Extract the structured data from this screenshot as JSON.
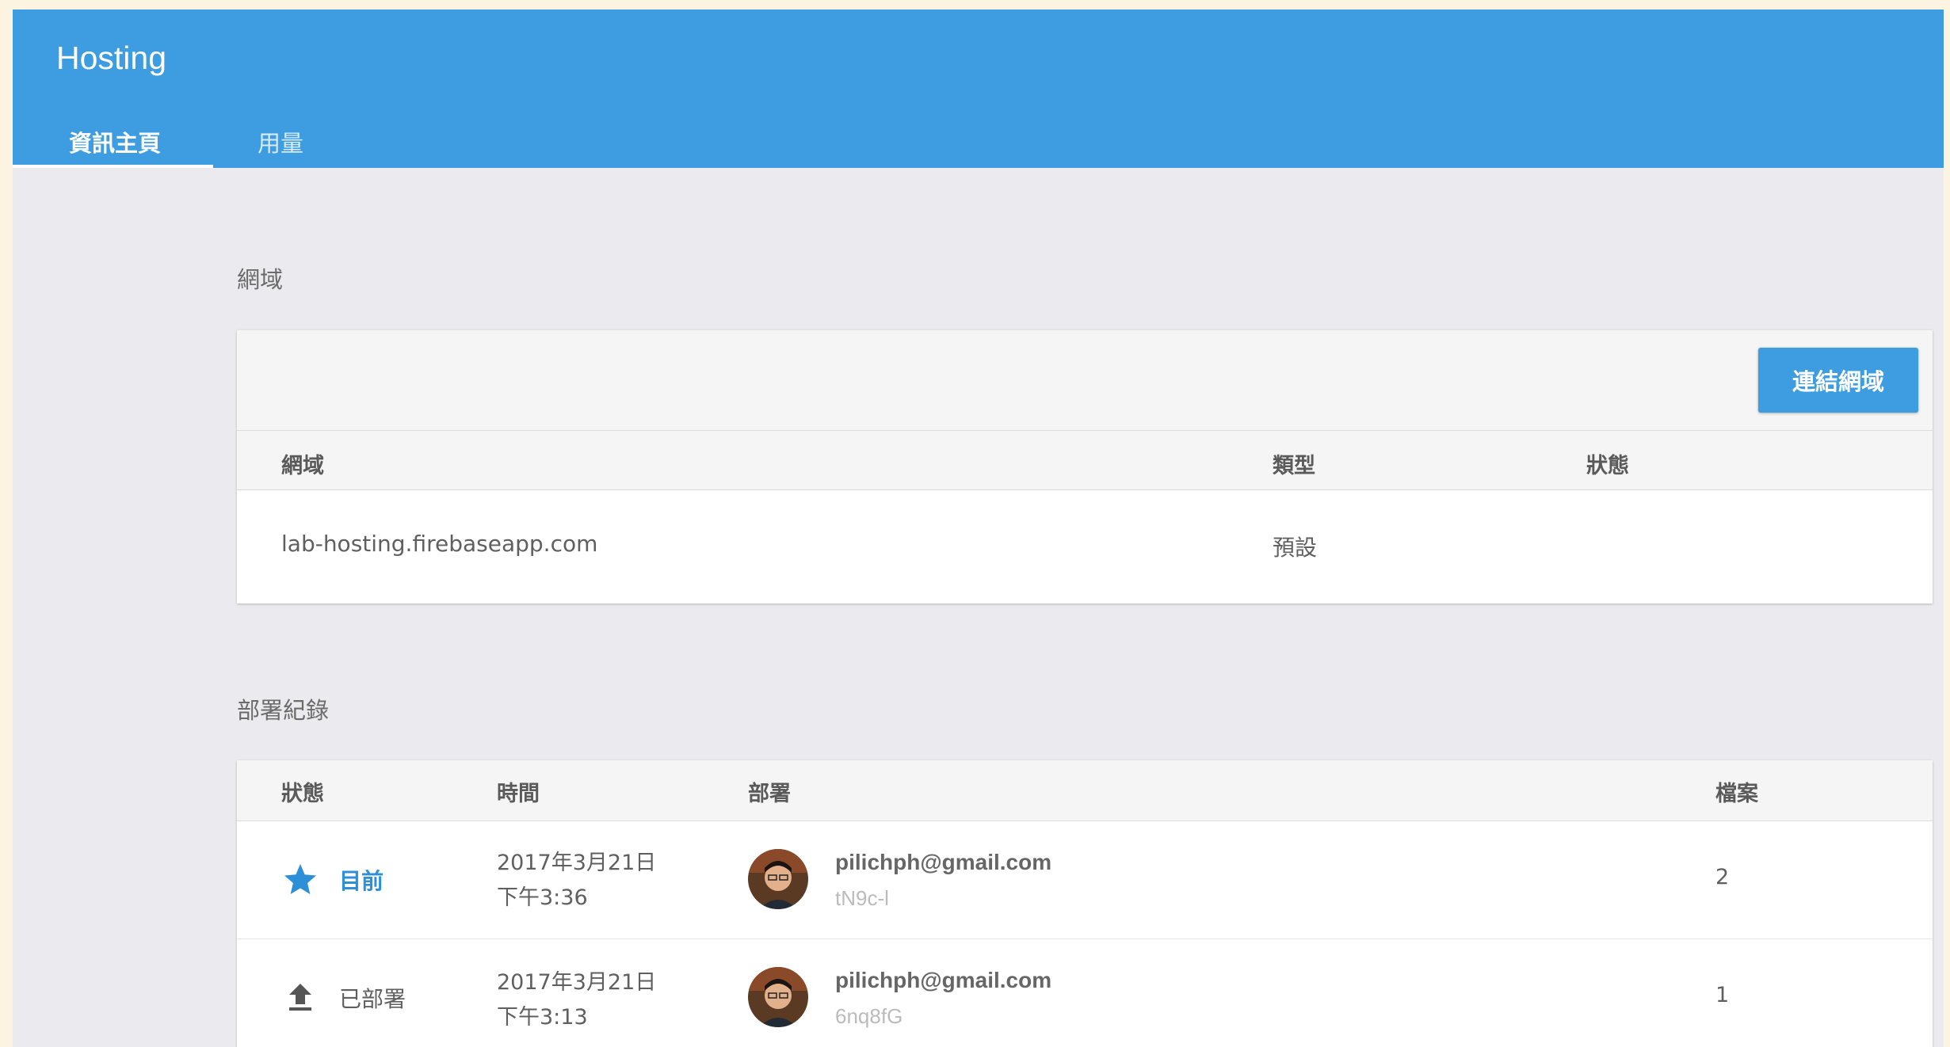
{
  "header": {
    "title": "Hosting",
    "tabs": [
      {
        "label": "資訊主頁",
        "active": true
      },
      {
        "label": "用量",
        "active": false
      }
    ]
  },
  "domains": {
    "section_title": "網域",
    "connect_button": "連結網域",
    "columns": [
      "網域",
      "類型",
      "狀態"
    ],
    "rows": [
      {
        "domain": "lab-hosting.firebaseapp.com",
        "type": "預設",
        "status": ""
      }
    ]
  },
  "deployments": {
    "section_title": "部署紀錄",
    "columns": [
      "狀態",
      "時間",
      "部署",
      "檔案"
    ],
    "rows": [
      {
        "status": "目前",
        "status_icon": "star-icon",
        "date": "2017年3月21日",
        "time": "下午3:36",
        "email": "pilichph@gmail.com",
        "hash": "tN9c-l",
        "files": "2"
      },
      {
        "status": "已部署",
        "status_icon": "upload-icon",
        "date": "2017年3月21日",
        "time": "下午3:13",
        "email": "pilichph@gmail.com",
        "hash": "6nq8fG",
        "files": "1"
      }
    ]
  },
  "colors": {
    "brand": "#3e9de0",
    "accent_text": "#2d8fd8",
    "background": "#ebebef"
  }
}
